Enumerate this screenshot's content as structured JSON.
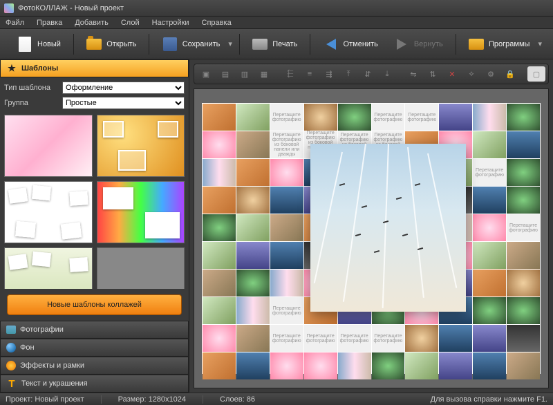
{
  "window": {
    "title": "ФотоКОЛЛАЖ - Новый проект"
  },
  "menu": {
    "items": [
      "Файл",
      "Правка",
      "Добавить",
      "Слой",
      "Настройки",
      "Справка"
    ]
  },
  "toolbar": {
    "new": "Новый",
    "open": "Открыть",
    "save": "Сохранить",
    "print": "Печать",
    "undo": "Отменить",
    "redo": "Вернуть",
    "apps": "Программы"
  },
  "sidebar": {
    "templates": {
      "title": "Шаблоны",
      "type_label": "Тип шаблона",
      "type_value": "Оформление",
      "group_label": "Группа",
      "group_value": "Простые",
      "new_btn": "Новые шаблоны коллажей"
    },
    "photos": {
      "title": "Фотографии"
    },
    "background": {
      "title": "Фон"
    },
    "effects": {
      "title": "Эффекты и рамки"
    },
    "text": {
      "title": "Текст и украшения"
    }
  },
  "placeholders": {
    "drag1": "Перетащите\nфотографию",
    "drag2": "Перетащите\nфотографию\nиз боковой панели\nили дважды",
    "drag3": "Перетащите\nфотографию\nиз боковой панели\nили дважды кликните"
  },
  "statusbar": {
    "project": "Проект: Новый проект",
    "size": "Размер: 1280x1024",
    "layers": "Слоев: 86",
    "help": "Для вызова справки нажмите F1."
  }
}
